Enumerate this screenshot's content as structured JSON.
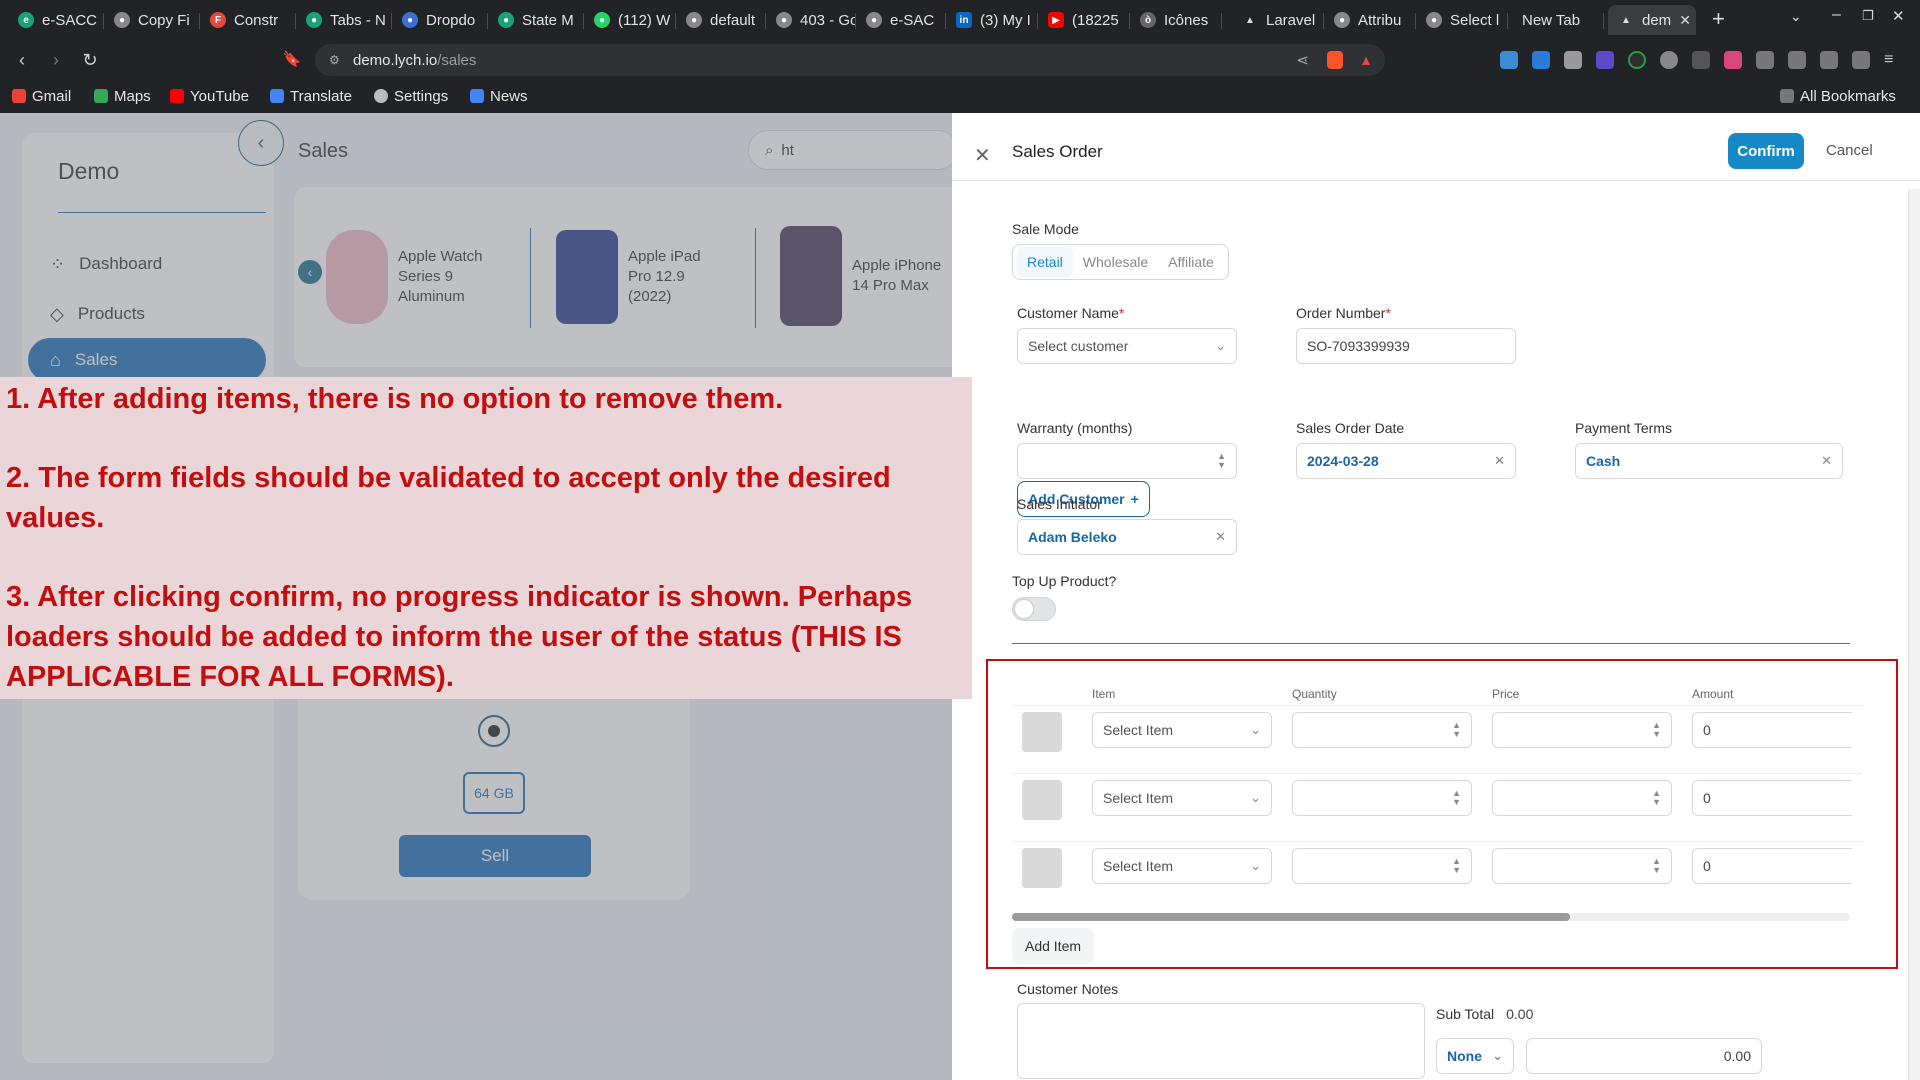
{
  "browser": {
    "tabs": [
      {
        "label": "e-SACC",
        "color": "#1aa37a"
      },
      {
        "label": "Copy Fi",
        "color": "#888"
      },
      {
        "label": "Constr",
        "color": "#e24a3b"
      },
      {
        "label": "Tabs - N",
        "color": "#1aa37a"
      },
      {
        "label": "Dropdo",
        "color": "#3c6fd6"
      },
      {
        "label": "State M",
        "color": "#1aa37a"
      },
      {
        "label": "(112) W",
        "color": "#25d366"
      },
      {
        "label": "default",
        "color": "#888"
      },
      {
        "label": "403 - Go",
        "color": "#888"
      },
      {
        "label": "e-SAC",
        "color": "#888"
      },
      {
        "label": "(3) My I",
        "color": "#0a66c2"
      },
      {
        "label": "(18225",
        "color": "#ff0000"
      },
      {
        "label": "Icônes",
        "color": "#888"
      },
      {
        "label": "Laravel",
        "color": "#888"
      },
      {
        "label": "Attribu",
        "color": "#888"
      },
      {
        "label": "Select l",
        "color": "#888"
      },
      {
        "label": "New Tab",
        "color": ""
      },
      {
        "label": "dem",
        "color": "#888"
      }
    ],
    "url_domain": "demo.lych.io",
    "url_path": "/sales",
    "bookmarks": [
      {
        "label": "Gmail",
        "color": "#ea4335"
      },
      {
        "label": "Maps",
        "color": "#34a853"
      },
      {
        "label": "YouTube",
        "color": "#ff0000"
      },
      {
        "label": "Translate",
        "color": "#4285f4"
      },
      {
        "label": "Settings",
        "color": "#bbb"
      },
      {
        "label": "News",
        "color": "#4285f4"
      }
    ],
    "all_bookmarks": "All Bookmarks"
  },
  "app": {
    "brand": "Demo",
    "nav": [
      {
        "label": "Dashboard",
        "icon": "grid-icon"
      },
      {
        "label": "Products",
        "icon": "diamond-icon"
      },
      {
        "label": "Sales",
        "icon": "tag-icon"
      }
    ],
    "page_title": "Sales",
    "search_value": "ht",
    "products": [
      {
        "name": "Apple Watch Series 9 Aluminum",
        "color": "#f2b9c4"
      },
      {
        "name": "Apple iPad Pro 12.9 (2022)",
        "color": "#2b3c8a"
      },
      {
        "name": "Apple iPhone 14 Pro Max",
        "color": "#4a3a5a"
      }
    ],
    "storage_option": "64 GB",
    "sell_label": "Sell"
  },
  "annotation": {
    "lines": [
      "1. After adding items, there is no option to remove them.",
      "2. The form fields should be validated to accept only the desired values.",
      "3. After clicking confirm, no progress indicator is shown. Perhaps loaders should be added to inform the user of the status (THIS IS APPLICABLE FOR ALL FORMS)."
    ],
    "color": "#c10f0f"
  },
  "drawer": {
    "title": "Sales Order",
    "confirm": "Confirm",
    "cancel": "Cancel",
    "sale_mode_label": "Sale Mode",
    "sale_modes": [
      "Retail",
      "Wholesale",
      "Affiliate"
    ],
    "customer_label": "Customer Name",
    "customer_placeholder": "Select customer",
    "order_number_label": "Order Number",
    "order_number": "SO-7093399939",
    "add_customer": "Add Customer",
    "warranty_label": "Warranty (months)",
    "warranty_value": "",
    "date_label": "Sales Order Date",
    "date_value": "2024-03-28",
    "terms_label": "Payment Terms",
    "terms_value": "Cash",
    "initiator_label": "Sales Initiator",
    "initiator_value": "Adam Beleko",
    "topup_label": "Top Up Product?",
    "items_headers": [
      "Item",
      "Quantity",
      "Price",
      "Amount"
    ],
    "items": [
      {
        "item": "Select Item",
        "amount": "0"
      },
      {
        "item": "Select Item",
        "amount": "0"
      },
      {
        "item": "Select Item",
        "amount": "0"
      }
    ],
    "add_item": "Add Item",
    "notes_label": "Customer Notes",
    "subtotal_label": "Sub Total",
    "subtotal_value": "0.00",
    "discount_type": "None",
    "discount_value": "0.00",
    "accent": "#1689c7"
  }
}
